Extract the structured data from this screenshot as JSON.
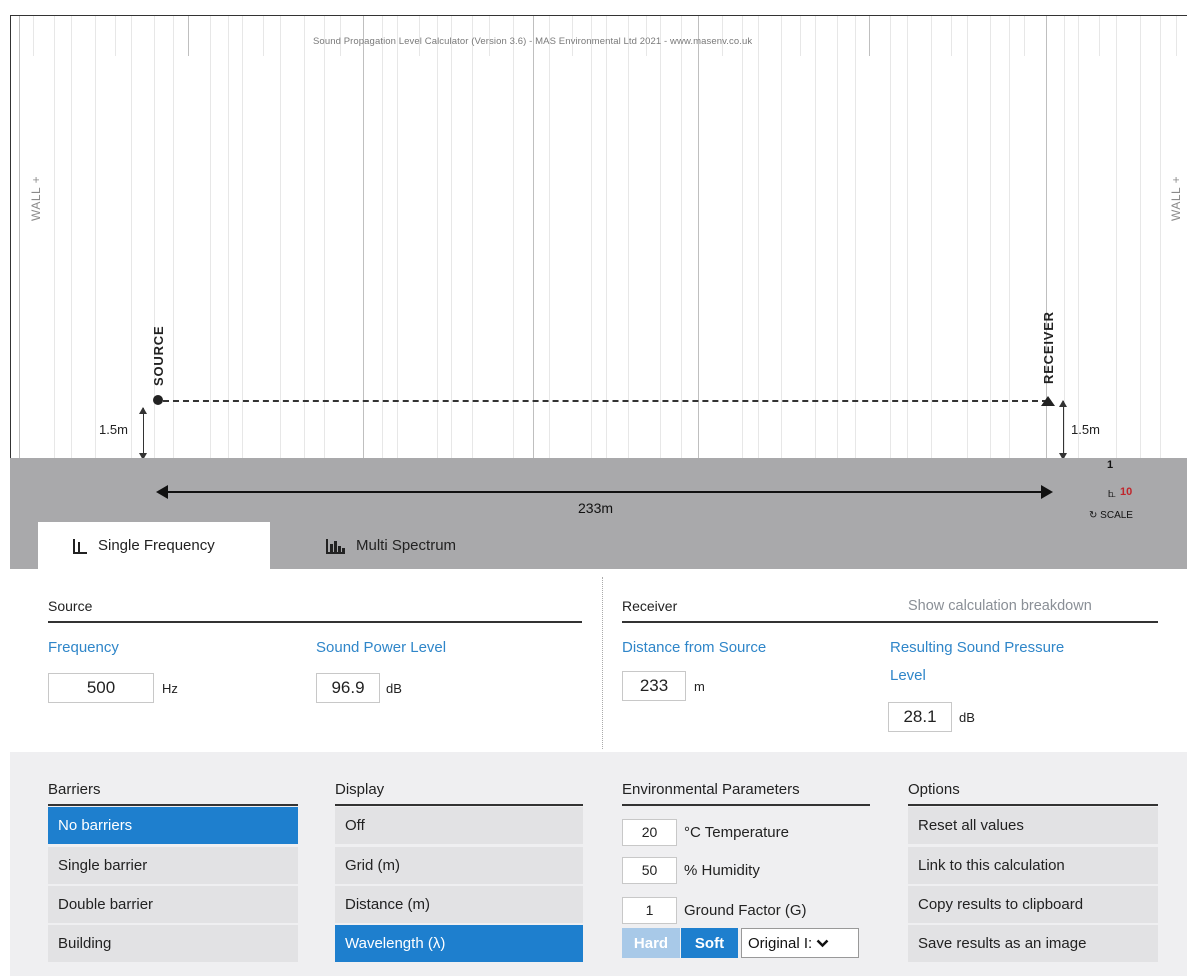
{
  "app": {
    "title": "Sound Propagation Level Calculator (Version 3.6) - MAS Environmental Ltd 2021 - www.masenv.co.uk"
  },
  "scene": {
    "wall_left_label": "WALL +",
    "wall_right_label": "WALL +",
    "source_label": "SOURCE",
    "receiver_label": "RECEIVER",
    "source_height": "1.5m",
    "receiver_height": "1.5m",
    "distance_label": "233m",
    "scale": {
      "vertical_value": "1",
      "horizontal_value": "10",
      "button_label": "SCALE",
      "icon": "rotate-icon"
    },
    "colors": {
      "ground": "#a9a9ab",
      "scale_accent": "#c0262c"
    }
  },
  "tabs": [
    {
      "label": "Single Frequency",
      "icon": "single-frequency-icon",
      "active": true
    },
    {
      "label": "Multi Spectrum",
      "icon": "multi-spectrum-icon",
      "active": false
    }
  ],
  "source": {
    "section_title": "Source",
    "frequency_label": "Frequency",
    "frequency_value": "500",
    "frequency_unit": "Hz",
    "power_label": "Sound Power Level",
    "power_value": "96.9",
    "power_unit": "dB"
  },
  "receiver": {
    "section_title": "Receiver",
    "breakdown_link": "Show calculation breakdown",
    "distance_label": "Distance from Source",
    "distance_value": "233",
    "distance_unit": "m",
    "spl_label_line1": "Resulting Sound Pressure",
    "spl_label_line2": "Level",
    "spl_value": "28.1",
    "spl_unit": "dB"
  },
  "barriers": {
    "title": "Barriers",
    "items": [
      "No barriers",
      "Single barrier",
      "Double barrier",
      "Building"
    ],
    "selected": "No barriers"
  },
  "display": {
    "title": "Display",
    "items": [
      "Off",
      "Grid (m)",
      "Distance (m)",
      "Wavelength (λ)"
    ],
    "selected": "Wavelength (λ)"
  },
  "environment": {
    "title": "Environmental Parameters",
    "temperature_value": "20",
    "temperature_label": "°C Temperature",
    "humidity_value": "50",
    "humidity_label": "% Humidity",
    "ground_value": "1",
    "ground_label": "Ground Factor (G)",
    "hard_label": "Hard",
    "soft_label": "Soft",
    "ground_type_selected": "Original I:"
  },
  "options": {
    "title": "Options",
    "items": [
      "Reset all values",
      "Link to this calculation",
      "Copy results to clipboard",
      "Save results as an image"
    ]
  },
  "colors": {
    "accent": "#1e7fce",
    "label_blue": "#2f86c9",
    "panel_bg": "#efeff1",
    "button_bg": "#e2e2e4"
  }
}
